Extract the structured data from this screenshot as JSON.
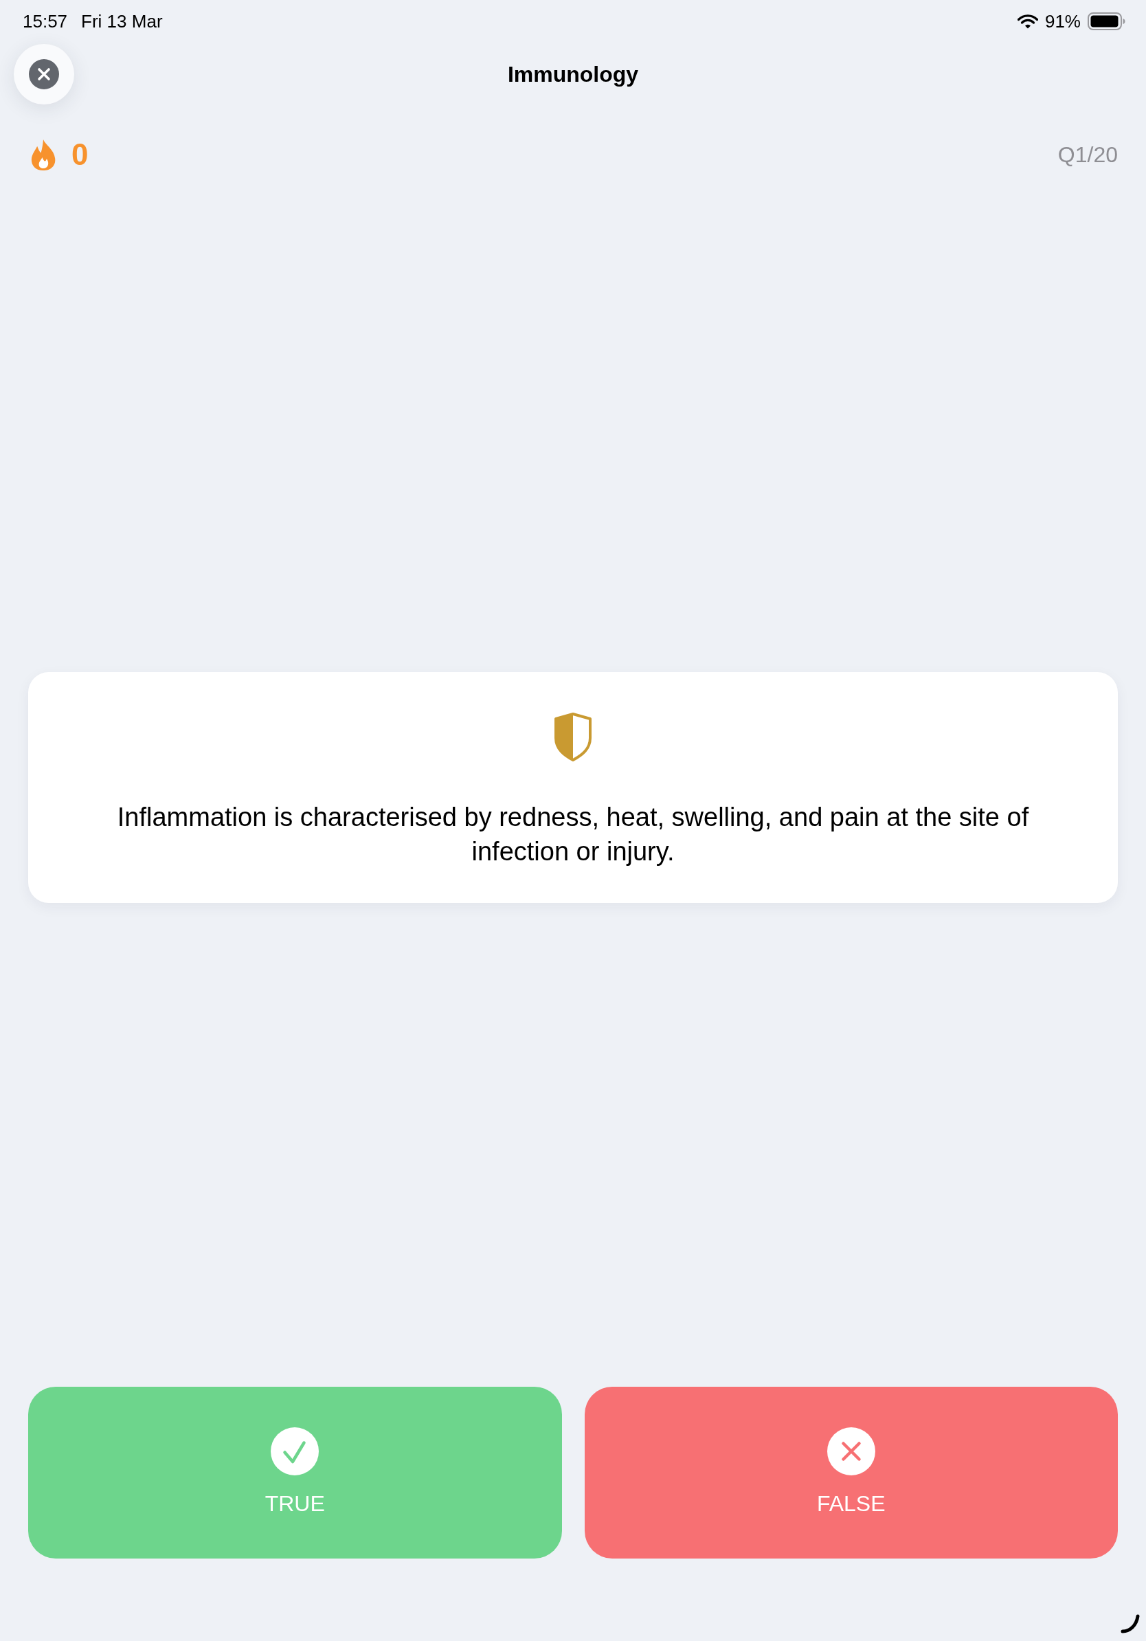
{
  "status_bar": {
    "time": "15:57",
    "date": "Fri 13 Mar",
    "battery": "91%"
  },
  "header": {
    "title": "Immunology"
  },
  "streak": {
    "count": "0"
  },
  "progress": {
    "label": "Q1/20"
  },
  "question": {
    "text": "Inflammation is characterised by redness, heat, swelling, and pain at the site of infection or injury."
  },
  "answers": [
    {
      "kind": "true",
      "label": "TRUE"
    },
    {
      "kind": "false",
      "label": "FALSE"
    }
  ]
}
